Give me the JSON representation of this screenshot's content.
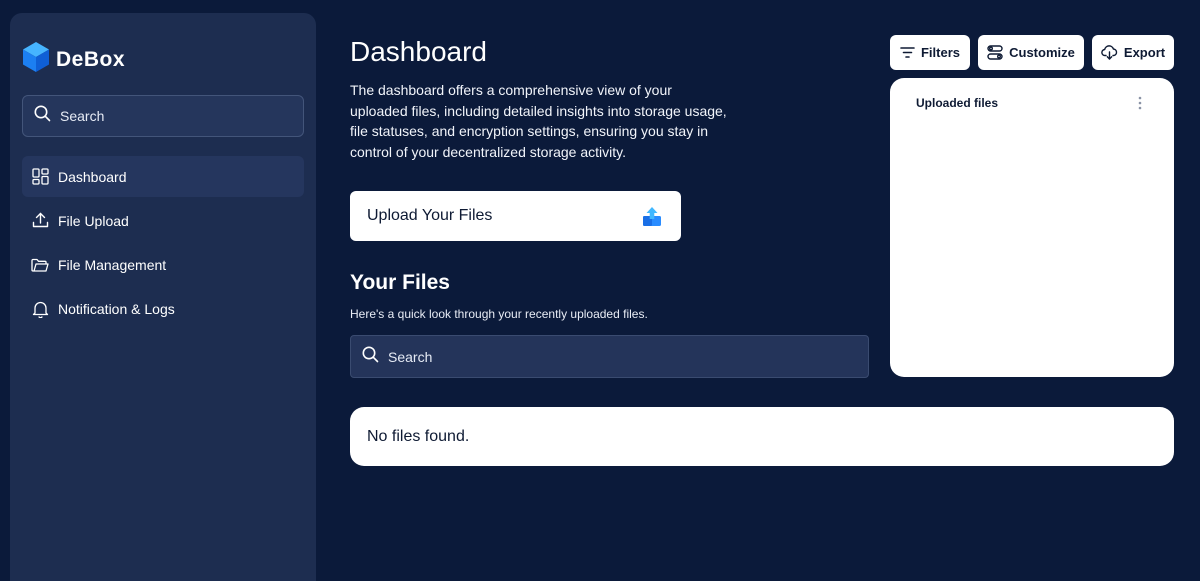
{
  "brand": {
    "name": "DeBox"
  },
  "sidebar": {
    "search_placeholder": "Search",
    "items": [
      {
        "label": "Dashboard",
        "icon": "grid-icon",
        "active": true
      },
      {
        "label": "File Upload",
        "icon": "upload-icon",
        "active": false
      },
      {
        "label": "File Management",
        "icon": "folder-icon",
        "active": false
      },
      {
        "label": "Notification & Logs",
        "icon": "bell-icon",
        "active": false
      }
    ]
  },
  "main": {
    "title": "Dashboard",
    "description": "The dashboard offers a comprehensive view of your uploaded files, including detailed insights into storage usage, file statuses, and encryption settings, ensuring you stay in control of your decentralized storage activity.",
    "upload_label": "Upload Your Files",
    "files_title": "Your Files",
    "files_subtitle": "Here's a quick look through your recently uploaded files.",
    "search_placeholder": "Search",
    "empty_text": "No files found."
  },
  "toolbar": {
    "filters_label": "Filters",
    "customize_label": "Customize",
    "export_label": "Export"
  },
  "chart_card": {
    "title": "Uploaded files"
  },
  "colors": {
    "background": "#0b1a3a",
    "sidebar": "#1d2d50",
    "active_item": "#25365e",
    "accent": "#1e8fff"
  }
}
